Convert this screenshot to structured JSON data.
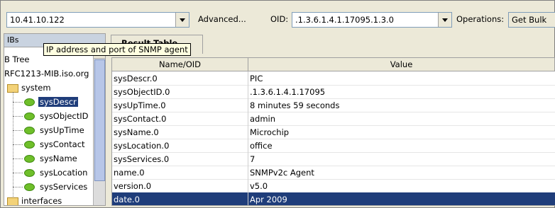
{
  "toolbar": {
    "agent_address": "10.41.10.122",
    "advanced_label": "Advanced...",
    "oid_label": "OID:",
    "oid_value": ".1.3.6.1.4.1.17095.1.3.0",
    "operations_label": "Operations:",
    "operation_value": "Get Bulk"
  },
  "tooltip": "IP address and port of SNMP agent",
  "tree": {
    "header": "IBs",
    "items": [
      {
        "label": "B Tree"
      },
      {
        "label": "RFC1213-MIB.iso.org"
      },
      {
        "label": "system"
      },
      {
        "label": "sysDescr"
      },
      {
        "label": "sysObjectID"
      },
      {
        "label": "sysUpTime"
      },
      {
        "label": "sysContact"
      },
      {
        "label": "sysName"
      },
      {
        "label": "sysLocation"
      },
      {
        "label": "sysServices"
      },
      {
        "label": "interfaces"
      }
    ]
  },
  "result_tab": "Result Table",
  "table": {
    "columns": [
      "Name/OID",
      "Value"
    ],
    "rows": [
      {
        "name": "sysDescr.0",
        "value": "PIC"
      },
      {
        "name": "sysObjectID.0",
        "value": ".1.3.6.1.4.1.17095"
      },
      {
        "name": "sysUpTime.0",
        "value": "8 minutes 59 seconds"
      },
      {
        "name": "sysContact.0",
        "value": "admin"
      },
      {
        "name": "sysName.0",
        "value": "Microchip"
      },
      {
        "name": "sysLocation.0",
        "value": "office"
      },
      {
        "name": "sysServices.0",
        "value": "7"
      },
      {
        "name": "name.0",
        "value": "SNMPv2c Agent"
      },
      {
        "name": "version.0",
        "value": "v5.0"
      },
      {
        "name": "date.0",
        "value": "Apr 2009"
      }
    ]
  },
  "colors": {
    "selection": "#1f3d7a",
    "leaf_icon": "#6fbf2a",
    "folder_icon": "#f3d278"
  },
  "icons": {
    "leaf": "leaf-node-icon",
    "folder": "folder-icon",
    "dropdown": "chevron-down-icon"
  }
}
